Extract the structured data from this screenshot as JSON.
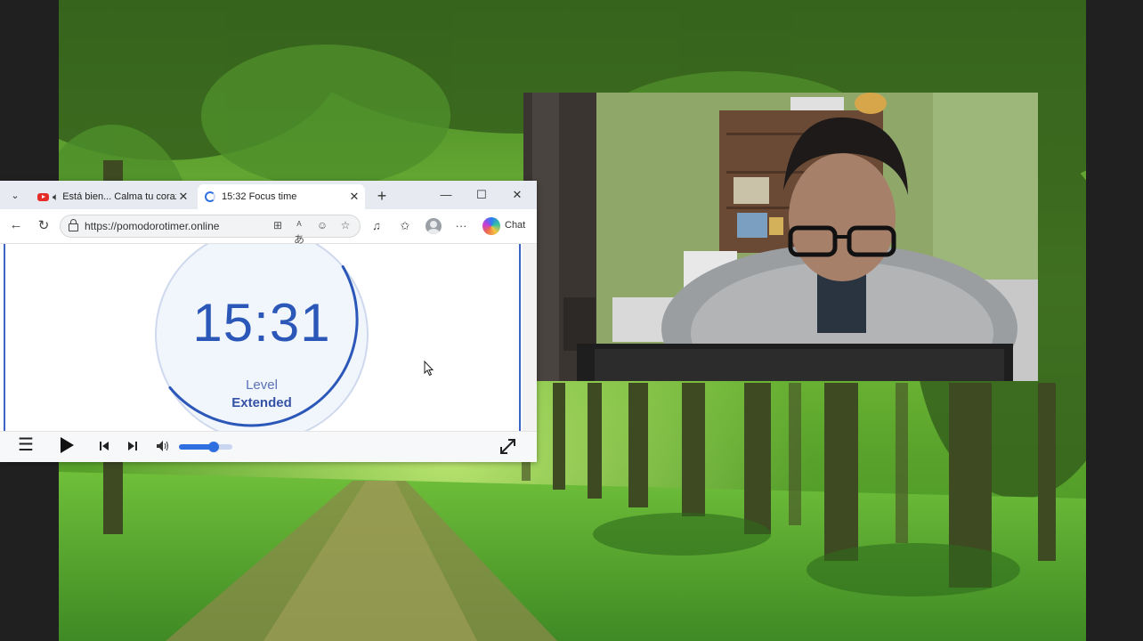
{
  "browser": {
    "tab_list_icon": "chevron-down-icon",
    "tabs": [
      {
        "title": "Está bien... Calma tu corazón",
        "icons": [
          "youtube-icon",
          "speaker-icon"
        ],
        "close": "✕"
      },
      {
        "title": "15:32 Focus time",
        "icons": [
          "loading-spinner-icon"
        ],
        "close": "✕"
      }
    ],
    "new_tab": "+",
    "window_controls": [
      "—",
      "☐",
      "✕"
    ],
    "address": "https://pomodorotimer.online",
    "toolbar_icons": [
      "split-screen-icon",
      "translate-icon",
      "reader-icon",
      "favorite-star-icon",
      "media-icon",
      "favorites-icon",
      "profile-icon",
      "more-icon",
      "copilot-icon"
    ],
    "more_label": "···",
    "chat_label": "Chat"
  },
  "timer": {
    "time": "15:31",
    "level_label": "Level",
    "level_value": "Extended",
    "ring_color": "#2a57b8",
    "track_color": "#cfd9ee"
  },
  "player": {
    "icons": [
      "menu-icon",
      "play-icon",
      "previous-icon",
      "next-icon",
      "volume-icon",
      "fullscreen-icon"
    ],
    "volume": 0.65,
    "accent": "#2f6fe0"
  },
  "colors": {
    "forest_dark": "#2f5a1e",
    "forest_light": "#8fd24a"
  }
}
